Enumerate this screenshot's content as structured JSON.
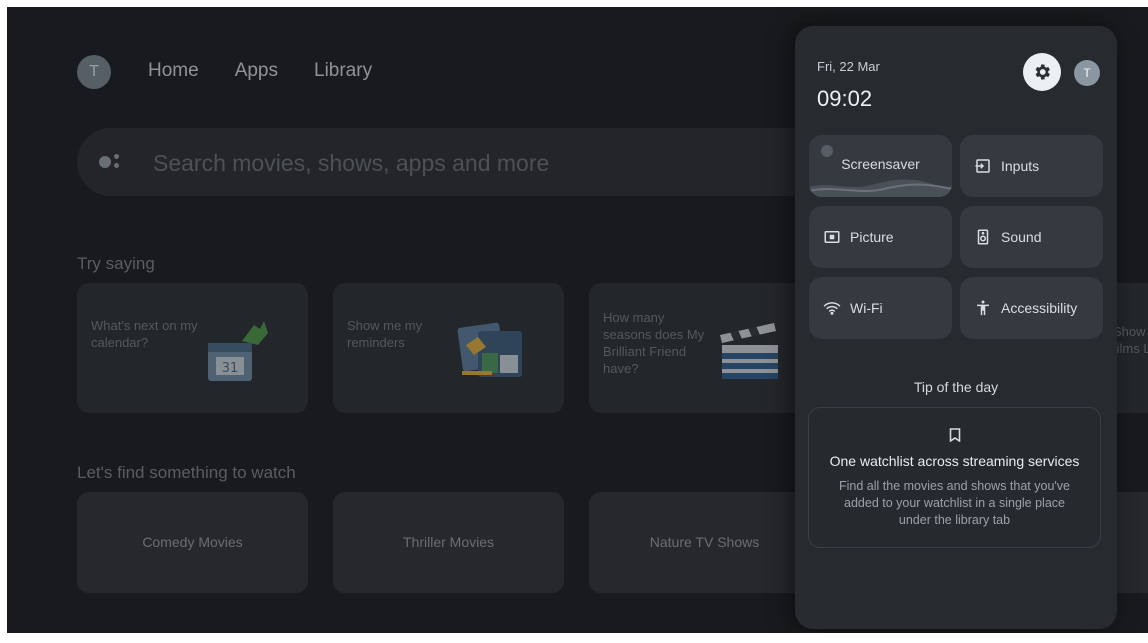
{
  "home": {
    "avatar_initial": "T",
    "nav": {
      "home": "Home",
      "apps": "Apps",
      "library": "Library"
    },
    "search_placeholder": "Search movies, shows, apps and more",
    "try_saying_title": "Try saying",
    "suggestions": [
      {
        "text": "What's next on my calendar?"
      },
      {
        "text": "Show me my reminders"
      },
      {
        "text": "How many seasons does My Brilliant Friend have?"
      },
      {
        "text": "Show films Lee"
      }
    ],
    "watch_title": "Let's find something to watch",
    "categories": [
      {
        "label": "Comedy Movies"
      },
      {
        "label": "Thriller Movies"
      },
      {
        "label": "Nature TV Shows"
      }
    ]
  },
  "panel": {
    "date": "Fri, 22 Mar",
    "time": "09:02",
    "avatar_initial": "T",
    "tiles": {
      "screensaver": "Screensaver",
      "inputs": "Inputs",
      "picture": "Picture",
      "sound": "Sound",
      "wifi": "Wi-Fi",
      "accessibility": "Accessibility"
    },
    "tip_title": "Tip of the day",
    "tip_heading": "One watchlist across streaming services",
    "tip_body": "Find all the movies and shows that you've added to your watchlist in a single place under the library tab"
  },
  "colors": {
    "background": "#181a1d",
    "panel": "#272b30",
    "tile": "#353a40"
  }
}
